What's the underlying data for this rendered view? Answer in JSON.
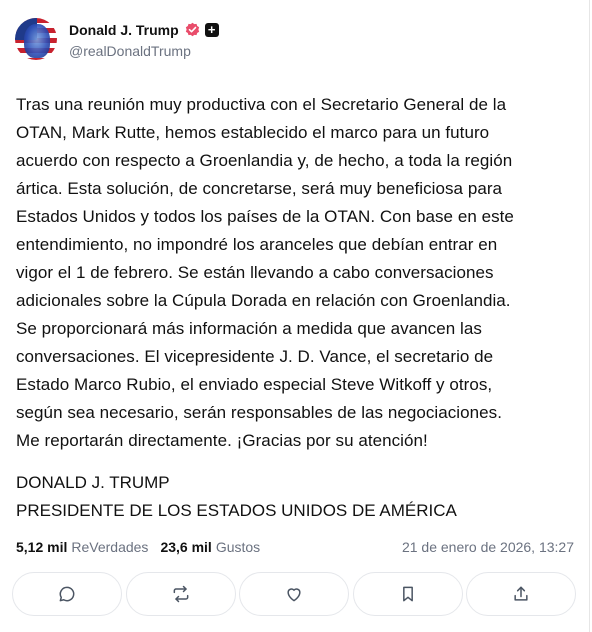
{
  "author": {
    "display_name": "Donald J. Trump",
    "handle": "@realDonaldTrump",
    "avatar_icon": "avatar-flag-portrait",
    "verified_color": "#e94d6b"
  },
  "post": {
    "text": "Tras una reunión muy productiva con el Secretario General de la\nOTAN, Mark Rutte, hemos establecido el marco para un futuro\nacuerdo con respecto a Groenlandia y, de hecho, a toda la región\nártica. Esta solución, de concretarse, será muy beneficiosa para\nEstados Unidos y todos los países de la OTAN. Con base en este\nentendimiento, no impondré los aranceles que debían entrar en\nvigor el 1 de febrero. Se están llevando a cabo conversaciones\nadicionales sobre la Cúpula Dorada en relación con Groenlandia.\nSe proporcionará más información a medida que avancen las\nconversaciones. El vicepresidente J. D. Vance, el secretario de\nEstado Marco Rubio, el enviado especial Steve Witkoff y otros,\nsegún sea necesario, serán responsables de las negociaciones.\nMe reportarán directamente. ¡Gracias por su atención!",
    "signature": "DONALD J. TRUMP\nPRESIDENTE DE LOS ESTADOS UNIDOS DE AMÉRICA"
  },
  "stats": {
    "reposts_count": "5,12 mil",
    "reposts_label": "ReVerdades",
    "likes_count": "23,6 mil",
    "likes_label": "Gustos",
    "timestamp": "21 de enero de 2026, 13:27"
  },
  "actions": [
    {
      "name": "reply",
      "icon": "chat-bubble-icon"
    },
    {
      "name": "retruth",
      "icon": "repost-icon"
    },
    {
      "name": "like",
      "icon": "heart-icon"
    },
    {
      "name": "bookmark",
      "icon": "bookmark-icon"
    },
    {
      "name": "share",
      "icon": "share-icon"
    }
  ]
}
